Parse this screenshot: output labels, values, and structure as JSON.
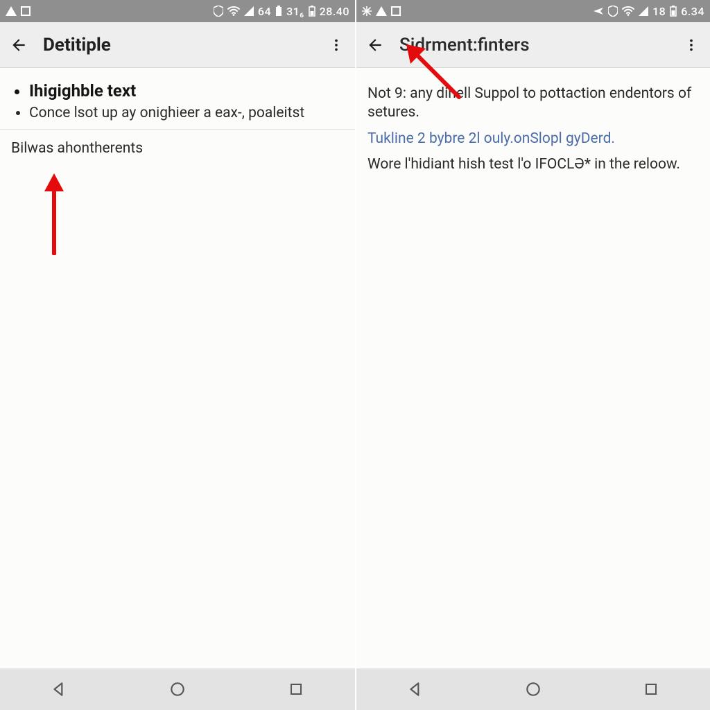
{
  "left": {
    "statusbar": {
      "signal_text": "64",
      "batt1_text": "31₆",
      "batt2_text": "28.40"
    },
    "appbar": {
      "title": "Detitiple"
    },
    "bullets": [
      "Ihigighble text",
      "Conce lsot up ay onighieer a eax-, poaleitst"
    ],
    "body_line": "Bilwas ahontherents"
  },
  "right": {
    "statusbar": {
      "signal_text": "18",
      "batt_text": "6.34"
    },
    "appbar": {
      "title": "Sidrment:finters"
    },
    "para1": "Not 9: any dinell Suppol to pottaction endentors of setures.",
    "link_line": "Tukline 2 bybre 2l ouly.onSlopl gyDerd.",
    "para2": "Wore l'hidiant hish test l'o IFOCLƏ* in the reloow."
  },
  "icons": {
    "back": "back-arrow",
    "more": "more-vert",
    "nav_back": "nav-back-triangle",
    "nav_home": "nav-home-circle",
    "nav_recent": "nav-recent-square"
  }
}
